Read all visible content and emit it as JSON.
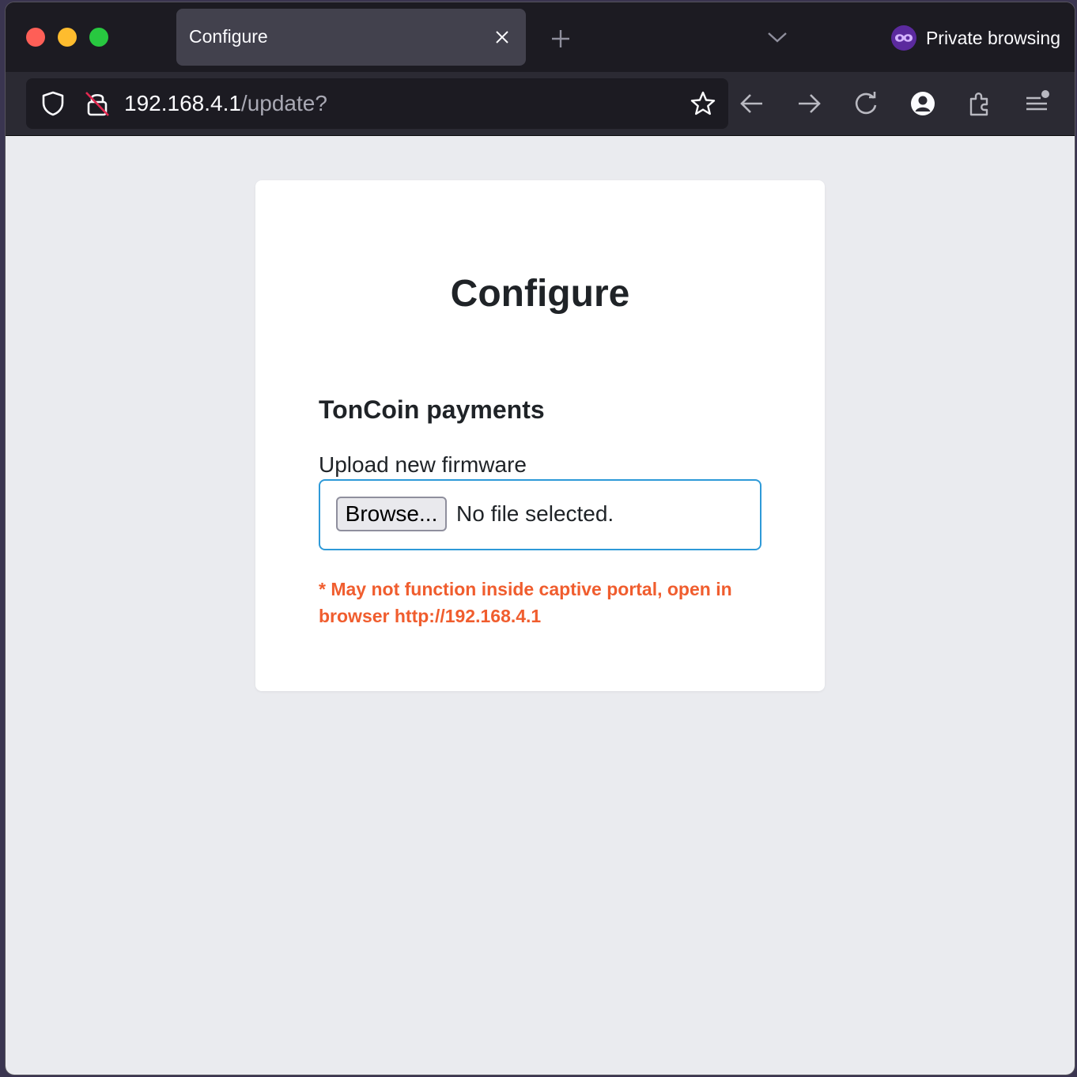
{
  "browser": {
    "tab_title": "Configure",
    "private_label": "Private browsing",
    "url_host": "192.168.4.1",
    "url_path": "/update?"
  },
  "page": {
    "title": "Configure",
    "section_title": "TonCoin payments",
    "upload_label": "Upload new firmware",
    "browse_button": "Browse...",
    "file_status": "No file selected.",
    "warning": "* May not function inside captive portal, open in browser http://192.168.4.1"
  },
  "colors": {
    "warning": "#f05d2e",
    "field_border": "#2e9ad8",
    "private_badge": "#5b2a9e"
  },
  "icons": [
    "shield-icon",
    "insecure-lock-icon",
    "bookmark-star-icon",
    "back-arrow-icon",
    "forward-arrow-icon",
    "reload-icon",
    "account-icon",
    "extensions-icon",
    "menu-icon",
    "close-icon",
    "plus-icon",
    "chevron-down-icon",
    "private-mask-icon"
  ]
}
